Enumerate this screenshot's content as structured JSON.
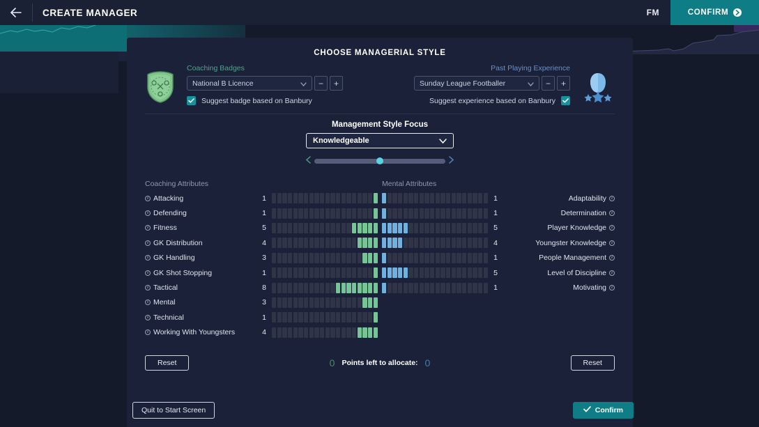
{
  "topbar": {
    "back_icon": "arrow-left-icon",
    "title": "CREATE MANAGER",
    "brand": "FM",
    "confirm_label": "CONFIRM"
  },
  "panel": {
    "title": "CHOOSE MANAGERIAL STYLE"
  },
  "coaching_badges": {
    "label": "Coaching Badges",
    "selected": "National B Licence",
    "decrement_label": "−",
    "increment_label": "+",
    "suggest_label": "Suggest badge based on Banbury",
    "suggest_checked": true,
    "crest_icon": "coaching-crest-icon"
  },
  "past_experience": {
    "label": "Past Playing Experience",
    "selected": "Sunday League Footballer",
    "decrement_label": "−",
    "increment_label": "+",
    "suggest_label": "Suggest experience based on Banbury",
    "suggest_checked": true,
    "player_icon": "player-silhouette-icon"
  },
  "style_focus": {
    "title": "Management Style Focus",
    "selected": "Knowledgeable",
    "slider_value": 50,
    "left_arrow_icon": "chevron-left-icon",
    "right_arrow_icon": "chevron-right-icon"
  },
  "coaching_attributes": {
    "heading": "Coaching Attributes",
    "max": 20,
    "accent": "#77c497",
    "items": [
      {
        "name": "Attacking",
        "value": 1
      },
      {
        "name": "Defending",
        "value": 1
      },
      {
        "name": "Fitness",
        "value": 5
      },
      {
        "name": "GK Distribution",
        "value": 4
      },
      {
        "name": "GK Handling",
        "value": 3
      },
      {
        "name": "GK Shot Stopping",
        "value": 1
      },
      {
        "name": "Tactical",
        "value": 8
      },
      {
        "name": "Mental",
        "value": 3
      },
      {
        "name": "Technical",
        "value": 1
      },
      {
        "name": "Working With Youngsters",
        "value": 4
      }
    ]
  },
  "mental_attributes": {
    "heading": "Mental Attributes",
    "max": 20,
    "accent": "#6fb2e0",
    "items": [
      {
        "name": "Adaptability",
        "value": 1
      },
      {
        "name": "Determination",
        "value": 1
      },
      {
        "name": "Player Knowledge",
        "value": 5
      },
      {
        "name": "Youngster Knowledge",
        "value": 4
      },
      {
        "name": "People Management",
        "value": 1
      },
      {
        "name": "Level of Discipline",
        "value": 5
      },
      {
        "name": "Motivating",
        "value": 1
      }
    ]
  },
  "allocation": {
    "reset_left_label": "Reset",
    "reset_right_label": "Reset",
    "points_left_value": "0",
    "points_label": "Points left to allocate:",
    "points_right_value": "0"
  },
  "footer": {
    "quit_label": "Quit to Start Screen",
    "confirm_label": "Confirm",
    "check_icon": "check-icon"
  }
}
